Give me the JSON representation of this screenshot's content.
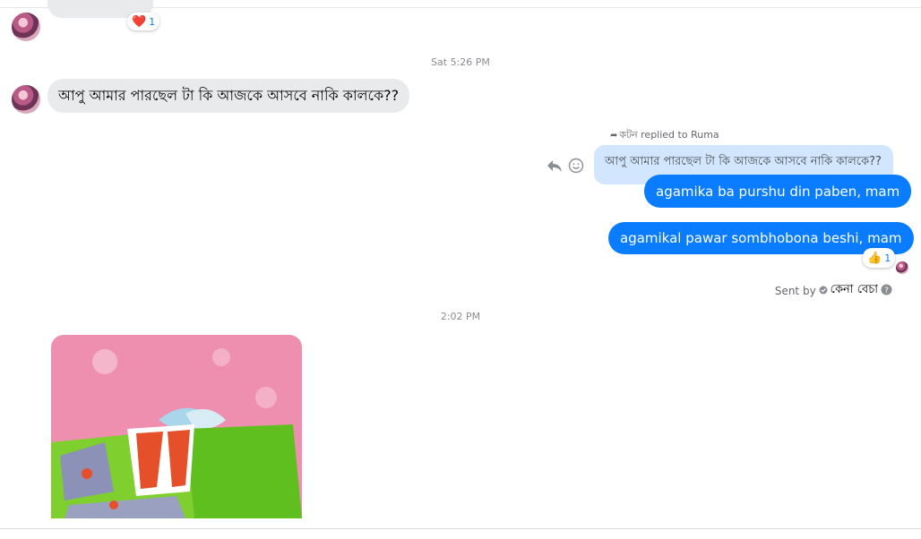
{
  "conversation": {
    "previous_message": {
      "reaction_emoji": "❤️",
      "reaction_count": "1"
    },
    "timestamps": {
      "sat": "Sat 5:26 PM",
      "afternoon": "2:02 PM"
    },
    "incoming_message": {
      "text": "আপু আমার পারছেল টা কি আজকে আসবে নাকি কালকে??"
    },
    "reply_block": {
      "reply_label": "কটন replied to Ruma",
      "quoted_text": "আপু আমার পারছেল টা কি আজকে আসবে নাকি কালকে??",
      "reply_text": "agamika ba purshu din paben, mam"
    },
    "outgoing_message": {
      "text": "agamikal pawar sombhobona beshi, mam",
      "reaction_emoji": "👍",
      "reaction_count": "1"
    },
    "sent_by": {
      "label": "Sent by",
      "name": "কেনা বেচা"
    }
  },
  "colors": {
    "outgoing_bubble": "#0a7cff",
    "incoming_bubble": "#e9eaec",
    "quoted_bubble": "#d2e6fd"
  }
}
